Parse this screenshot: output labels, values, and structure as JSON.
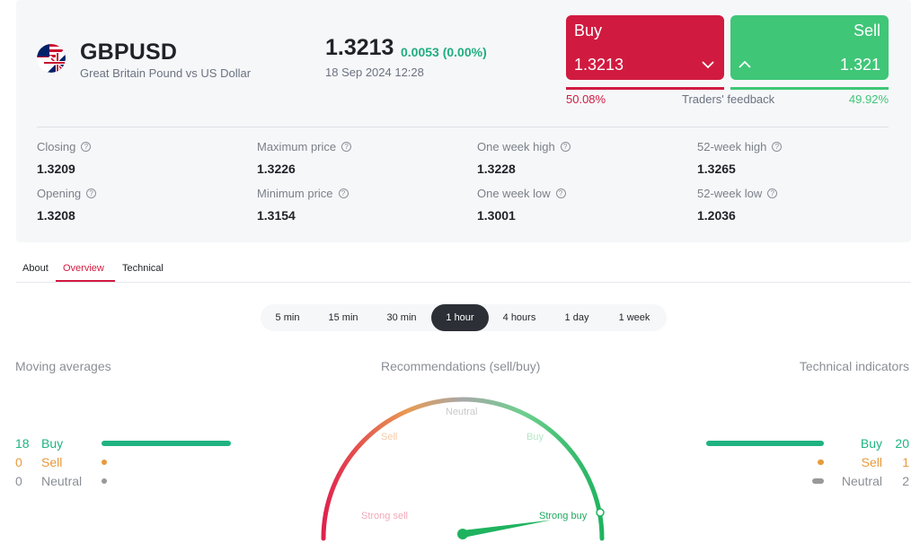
{
  "instrument": {
    "symbol": "GBPUSD",
    "name": "Great Britain Pound vs US Dollar",
    "price": "1.3213",
    "change": "0.0053 (0.00%)",
    "datetime": "18 Sep 2024 12:28",
    "flag_icon": "gb-us-flag-icon"
  },
  "trade": {
    "buy_label": "Buy",
    "buy_price": "1.3213",
    "sell_label": "Sell",
    "sell_price": "1.321",
    "feedback_buy": "50.08%",
    "feedback_label": "Traders' feedback",
    "feedback_sell": "49.92%",
    "buy_color": "#d11a40",
    "sell_color": "#3fc677"
  },
  "stats": [
    {
      "label": "Closing",
      "value": "1.3209"
    },
    {
      "label": "Maximum price",
      "value": "1.3226"
    },
    {
      "label": "One week high",
      "value": "1.3228"
    },
    {
      "label": "52-week high",
      "value": "1.3265"
    },
    {
      "label": "Opening",
      "value": "1.3208"
    },
    {
      "label": "Minimum price",
      "value": "1.3154"
    },
    {
      "label": "One week low",
      "value": "1.3001"
    },
    {
      "label": "52-week low",
      "value": "1.2036"
    }
  ],
  "tabs": [
    {
      "label": "About",
      "active": false
    },
    {
      "label": "Overview",
      "active": true
    },
    {
      "label": "Technical",
      "active": false
    }
  ],
  "periods": [
    "5 min",
    "15 min",
    "30 min",
    "1 hour",
    "4 hours",
    "1 day",
    "1 week"
  ],
  "active_period": "1 hour",
  "moving_averages": {
    "title": "Moving averages",
    "rows": [
      {
        "count": "18",
        "label": "Buy",
        "level": 1.0,
        "color": "#1fb381"
      },
      {
        "count": "0",
        "label": "Sell",
        "level": 0.0,
        "color": "#e89a3c"
      },
      {
        "count": "0",
        "label": "Neutral",
        "level": 0.0,
        "color": "#999999"
      }
    ]
  },
  "recommendations": {
    "title": "Recommendations (sell/buy)",
    "labels": {
      "strong_sell": "Strong sell",
      "sell": "Sell",
      "neutral": "Neutral",
      "buy": "Buy",
      "strong_buy": "Strong buy"
    },
    "needle_level": 0.95
  },
  "technical_indicators": {
    "title": "Technical indicators",
    "rows": [
      {
        "count": "20",
        "label": "Buy",
        "level": 1.0,
        "color": "#1fb381"
      },
      {
        "count": "1",
        "label": "Sell",
        "level": 0.05,
        "color": "#e89a3c"
      },
      {
        "count": "2",
        "label": "Neutral",
        "level": 0.1,
        "color": "#999999"
      }
    ]
  }
}
